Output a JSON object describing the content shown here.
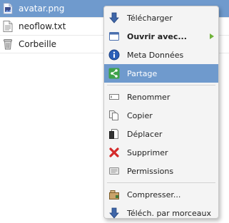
{
  "files": [
    {
      "name": "avatar.png",
      "icon": "image-file-icon",
      "selected": true
    },
    {
      "name": "neoflow.txt",
      "icon": "text-file-icon",
      "selected": false
    },
    {
      "name": "Corbeille",
      "icon": "trash-icon",
      "selected": false
    }
  ],
  "menu": {
    "items": [
      {
        "label": "Télécharger",
        "icon": "download-arrow-icon"
      },
      {
        "label": "Ouvrir avec...",
        "icon": "window-icon",
        "has_submenu": true
      },
      {
        "label": "Meta Données",
        "icon": "info-icon"
      },
      {
        "label": "Partage",
        "icon": "share-icon",
        "highlighted": true
      },
      {
        "label": "Renommer",
        "icon": "rename-icon"
      },
      {
        "label": "Copier",
        "icon": "copy-icon"
      },
      {
        "label": "Déplacer",
        "icon": "move-icon"
      },
      {
        "label": "Supprimer",
        "icon": "delete-x-icon"
      },
      {
        "label": "Permissions",
        "icon": "permissions-icon"
      },
      {
        "label": "Compresser...",
        "icon": "compress-icon"
      },
      {
        "label": "Téléch. par morceaux",
        "icon": "chunk-download-icon"
      }
    ]
  },
  "colors": {
    "selection": "#6f9acd",
    "submenu_arrow": "#6fb23a",
    "delete_red": "#d42a2a",
    "share_green": "#3fa24a"
  }
}
